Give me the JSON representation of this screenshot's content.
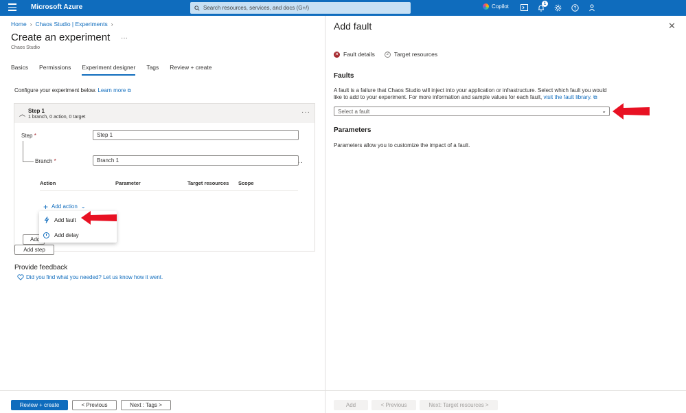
{
  "topbar": {
    "brand": "Microsoft Azure",
    "search_placeholder": "Search resources, services, and docs (G+/)",
    "copilot_label": "Copilot",
    "notification_count": "1"
  },
  "breadcrumb": {
    "items": [
      "Home",
      "Chaos Studio | Experiments"
    ]
  },
  "page": {
    "title": "Create an experiment",
    "subtitle": "Chaos Studio",
    "ellipsis": "···"
  },
  "tabs": [
    "Basics",
    "Permissions",
    "Experiment designer",
    "Tags",
    "Review + create"
  ],
  "designer": {
    "configure_text": "Configure your experiment below.",
    "learn_more": "Learn more",
    "step": {
      "name": "Step 1",
      "meta": "1 branch, 0 action, 0 target",
      "step_label": "Step",
      "step_value": "Step 1",
      "branch_label": "Branch",
      "branch_value": "Branch 1"
    },
    "columns": [
      "Action",
      "Parameter",
      "Target resources",
      "Scope"
    ],
    "add_action": "Add action",
    "add_partial": "Add",
    "menu": {
      "add_fault": "Add fault",
      "add_delay": "Add delay"
    },
    "add_step": "Add step"
  },
  "feedback": {
    "title": "Provide feedback",
    "link": "Did you find what you needed? Let us know how it went."
  },
  "left_footer": {
    "review_create": "Review + create",
    "previous": "< Previous",
    "next": "Next : Tags >"
  },
  "panel": {
    "title": "Add fault",
    "step1": "Fault details",
    "step2": "Target resources",
    "step2_num": "2",
    "faults_heading": "Faults",
    "description": "A fault is a failure that Chaos Studio will inject into your application or infrastructure. Select which fault you would like to add to your experiment. For more information and sample values for each fault,",
    "description_link": "visit the fault library.",
    "select_placeholder": "Select a fault",
    "params_heading": "Parameters",
    "params_desc": "Parameters allow you to customize the impact of a fault.",
    "footer": {
      "add": "Add",
      "previous": "< Previous",
      "next": "Next: Target resources >"
    }
  },
  "colors": {
    "azure_blue": "#0f6cbd",
    "arrow_red": "#e81123",
    "error_red": "#a4262c"
  }
}
